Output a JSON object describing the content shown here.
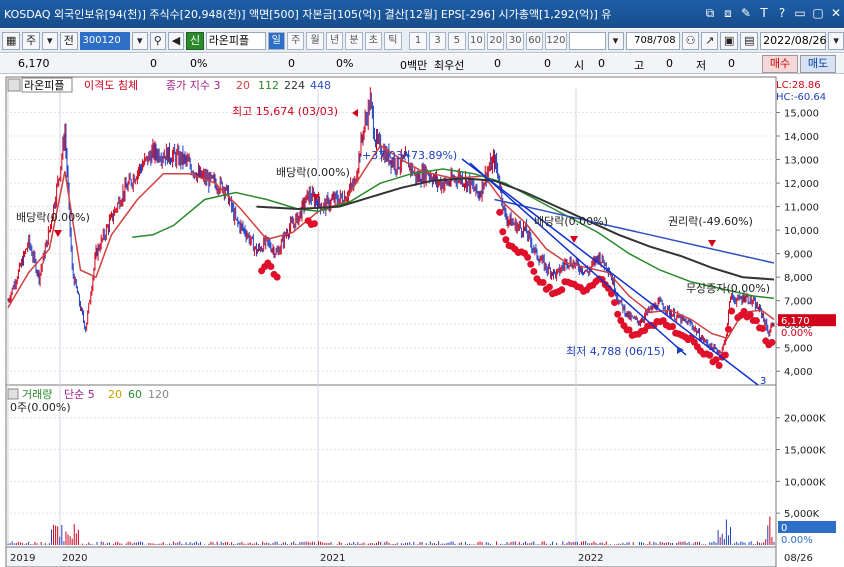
{
  "window": {
    "title": "KOSDAQ 외국인보유[94(천)] 주식수[20,948(천)] 액면[500] 자본금[105(억)] 결산[12월] EPS[-296] 시가총액[1,292(억)] 유",
    "icons": [
      "copy-icon",
      "restore-icon",
      "pin-icon",
      "text-icon",
      "help-icon",
      "minimize-icon",
      "maximize-icon",
      "close-icon"
    ],
    "icon_glyphs": [
      "⧉",
      "⧈",
      "✎",
      "T",
      "?",
      "▭",
      "▢",
      "✕"
    ]
  },
  "toolbar": {
    "type_select": "주",
    "prefix_label": "전",
    "code": "300120",
    "badge": "신",
    "stock_name": "라온피플",
    "period_buttons": [
      "일",
      "주",
      "월",
      "년",
      "분",
      "초",
      "틱"
    ],
    "period_selected": "일",
    "interval_buttons": [
      "1",
      "3",
      "5",
      "10",
      "20",
      "30",
      "60",
      "120"
    ],
    "count": "708",
    "count_total": "/708",
    "date": "2022/08/26"
  },
  "quote": {
    "price": "6,170",
    "change": "0",
    "change_rate": "0%",
    "volume": "0",
    "volume_rate": "0%",
    "amount": "0백만",
    "priority_label": "최우선",
    "bid": "0",
    "ask": "0",
    "open_label": "시",
    "open": "0",
    "high_label": "고",
    "high": "0",
    "low_label": "저",
    "low": "0",
    "sell_label": "매수",
    "buy_label": "매도"
  },
  "legend": {
    "name": "라온피플",
    "indicator": "이격도 침체",
    "ma_label": "종가 지수 3",
    "ma_periods": [
      "20",
      "112",
      "224",
      "448"
    ],
    "lc": "LC:28.86",
    "hc": "HC:-60.64"
  },
  "volume_legend": {
    "label": "거래량",
    "ma_label": "단순 5",
    "periods": [
      "20",
      "60",
      "120"
    ],
    "info": "0주(0.00%)"
  },
  "colors": {
    "up": "#d0021b",
    "down": "#1f3fbf",
    "ma20": "#d04040",
    "ma112": "#2a8a2a",
    "ma224": "#333333",
    "ma448": "#3050c0",
    "trend": "#1030d0",
    "accent": "#2d6fc7"
  },
  "chart_data": {
    "type": "line",
    "price_axis_ticks": [
      "15,000",
      "14,000",
      "13,000",
      "12,000",
      "11,000",
      "10,000",
      "9,000",
      "8,000",
      "7,000",
      "6,000",
      "5,000",
      "4,000"
    ],
    "ylim": [
      3500,
      16000
    ],
    "volume_axis_ticks": [
      "20,000K",
      "15,000K",
      "10,000K",
      "5,000K"
    ],
    "volume_ylim": [
      0,
      22000
    ],
    "x_labels": [
      "2019",
      "2020",
      "2021",
      "2022"
    ],
    "x_end_label": "08/26",
    "current_price_label": "6,170",
    "current_pct_label": "0.00%",
    "current_price": 6170,
    "volume_current_label": "0",
    "volume_current_pct": "0.00%",
    "trendline_label": "3",
    "annotations": [
      {
        "text": "최고 15,674 (03/03)",
        "value": 15674,
        "date": "03/03"
      },
      {
        "text": "최저 4,788 (06/15)",
        "value": 4788,
        "date": "06/15"
      },
      {
        "text": "배당락(0.00%)"
      },
      {
        "text": "배당락(0.00%)"
      },
      {
        "text": "+37.03(-73.89%)"
      },
      {
        "text": "배당락(0.00%)"
      },
      {
        "text": "권리락(-49.60%)"
      },
      {
        "text": "무상증자(0.00%)"
      }
    ],
    "series": [
      {
        "name": "종가",
        "points": [
          [
            0,
            7000
          ],
          [
            10,
            8200
          ],
          [
            20,
            9500
          ],
          [
            30,
            8000
          ],
          [
            40,
            10000
          ],
          [
            50,
            12500
          ],
          [
            55,
            14200
          ],
          [
            62,
            8300
          ],
          [
            70,
            6700
          ],
          [
            75,
            5800
          ],
          [
            85,
            9000
          ],
          [
            95,
            10000
          ],
          [
            110,
            11500
          ],
          [
            125,
            12500
          ],
          [
            140,
            13300
          ],
          [
            155,
            13200
          ],
          [
            170,
            13000
          ],
          [
            185,
            12300
          ],
          [
            200,
            12000
          ],
          [
            210,
            11800
          ],
          [
            220,
            10400
          ],
          [
            230,
            9900
          ],
          [
            240,
            9100
          ],
          [
            250,
            9500
          ],
          [
            260,
            9000
          ],
          [
            270,
            10000
          ],
          [
            280,
            10500
          ],
          [
            290,
            11500
          ],
          [
            305,
            11000
          ],
          [
            315,
            11300
          ],
          [
            325,
            11400
          ],
          [
            335,
            12000
          ],
          [
            343,
            14200
          ],
          [
            350,
            15500
          ],
          [
            355,
            13800
          ],
          [
            365,
            13200
          ],
          [
            375,
            12800
          ],
          [
            385,
            13000
          ],
          [
            395,
            12200
          ],
          [
            405,
            12500
          ],
          [
            415,
            12000
          ],
          [
            425,
            12000
          ],
          [
            435,
            12300
          ],
          [
            445,
            12000
          ],
          [
            455,
            11500
          ],
          [
            462,
            12400
          ],
          [
            470,
            13000
          ],
          [
            475,
            12000
          ],
          [
            480,
            10600
          ],
          [
            490,
            10200
          ],
          [
            500,
            10000
          ],
          [
            510,
            9000
          ],
          [
            520,
            8400
          ],
          [
            530,
            8100
          ],
          [
            540,
            8700
          ],
          [
            550,
            8500
          ],
          [
            560,
            8200
          ],
          [
            570,
            8900
          ],
          [
            580,
            8400
          ],
          [
            590,
            7000
          ],
          [
            600,
            6300
          ],
          [
            610,
            6100
          ],
          [
            620,
            6600
          ],
          [
            630,
            6900
          ],
          [
            640,
            6500
          ],
          [
            650,
            6200
          ],
          [
            660,
            6000
          ],
          [
            670,
            5400
          ],
          [
            680,
            5000
          ],
          [
            688,
            4800
          ],
          [
            693,
            5300
          ],
          [
            698,
            7200
          ],
          [
            705,
            7000
          ],
          [
            712,
            7200
          ],
          [
            720,
            6900
          ],
          [
            728,
            6500
          ],
          [
            735,
            5600
          ],
          [
            740,
            6170
          ]
        ]
      },
      {
        "name": "20",
        "points": [
          [
            0,
            6700
          ],
          [
            20,
            8200
          ],
          [
            40,
            9200
          ],
          [
            55,
            12500
          ],
          [
            70,
            8300
          ],
          [
            85,
            8000
          ],
          [
            100,
            9800
          ],
          [
            125,
            11300
          ],
          [
            150,
            12400
          ],
          [
            175,
            12400
          ],
          [
            200,
            12000
          ],
          [
            225,
            10900
          ],
          [
            250,
            9600
          ],
          [
            275,
            9900
          ],
          [
            300,
            10800
          ],
          [
            325,
            11200
          ],
          [
            345,
            12600
          ],
          [
            360,
            13600
          ],
          [
            380,
            13000
          ],
          [
            400,
            12500
          ],
          [
            430,
            12200
          ],
          [
            460,
            12300
          ],
          [
            480,
            11100
          ],
          [
            500,
            10300
          ],
          [
            520,
            9200
          ],
          [
            540,
            8600
          ],
          [
            560,
            8400
          ],
          [
            580,
            8200
          ],
          [
            600,
            7200
          ],
          [
            620,
            6500
          ],
          [
            640,
            6600
          ],
          [
            660,
            6200
          ],
          [
            680,
            5600
          ],
          [
            695,
            5400
          ],
          [
            710,
            6500
          ],
          [
            728,
            6600
          ],
          [
            740,
            6200
          ]
        ]
      },
      {
        "name": "112",
        "points": [
          [
            120,
            9700
          ],
          [
            140,
            9800
          ],
          [
            160,
            10200
          ],
          [
            190,
            11300
          ],
          [
            220,
            11600
          ],
          [
            250,
            11300
          ],
          [
            280,
            10900
          ],
          [
            300,
            10800
          ],
          [
            330,
            11200
          ],
          [
            360,
            12000
          ],
          [
            390,
            12400
          ],
          [
            420,
            12600
          ],
          [
            450,
            12400
          ],
          [
            480,
            12000
          ],
          [
            510,
            11300
          ],
          [
            540,
            10600
          ],
          [
            570,
            9900
          ],
          [
            600,
            9000
          ],
          [
            630,
            8300
          ],
          [
            660,
            7800
          ],
          [
            690,
            7500
          ],
          [
            720,
            7200
          ],
          [
            740,
            7100
          ]
        ]
      },
      {
        "name": "224",
        "points": [
          [
            240,
            11000
          ],
          [
            280,
            10900
          ],
          [
            320,
            11000
          ],
          [
            350,
            11400
          ],
          [
            380,
            11800
          ],
          [
            410,
            12100
          ],
          [
            440,
            12200
          ],
          [
            470,
            12100
          ],
          [
            500,
            11600
          ],
          [
            530,
            11000
          ],
          [
            560,
            10400
          ],
          [
            590,
            9800
          ],
          [
            620,
            9300
          ],
          [
            650,
            8900
          ],
          [
            680,
            8400
          ],
          [
            710,
            8000
          ],
          [
            740,
            7900
          ]
        ]
      },
      {
        "name": "448",
        "points": [
          [
            470,
            11300
          ],
          [
            520,
            10800
          ],
          [
            570,
            10300
          ],
          [
            620,
            9800
          ],
          [
            670,
            9300
          ],
          [
            710,
            8900
          ],
          [
            740,
            8600
          ]
        ]
      }
    ]
  }
}
